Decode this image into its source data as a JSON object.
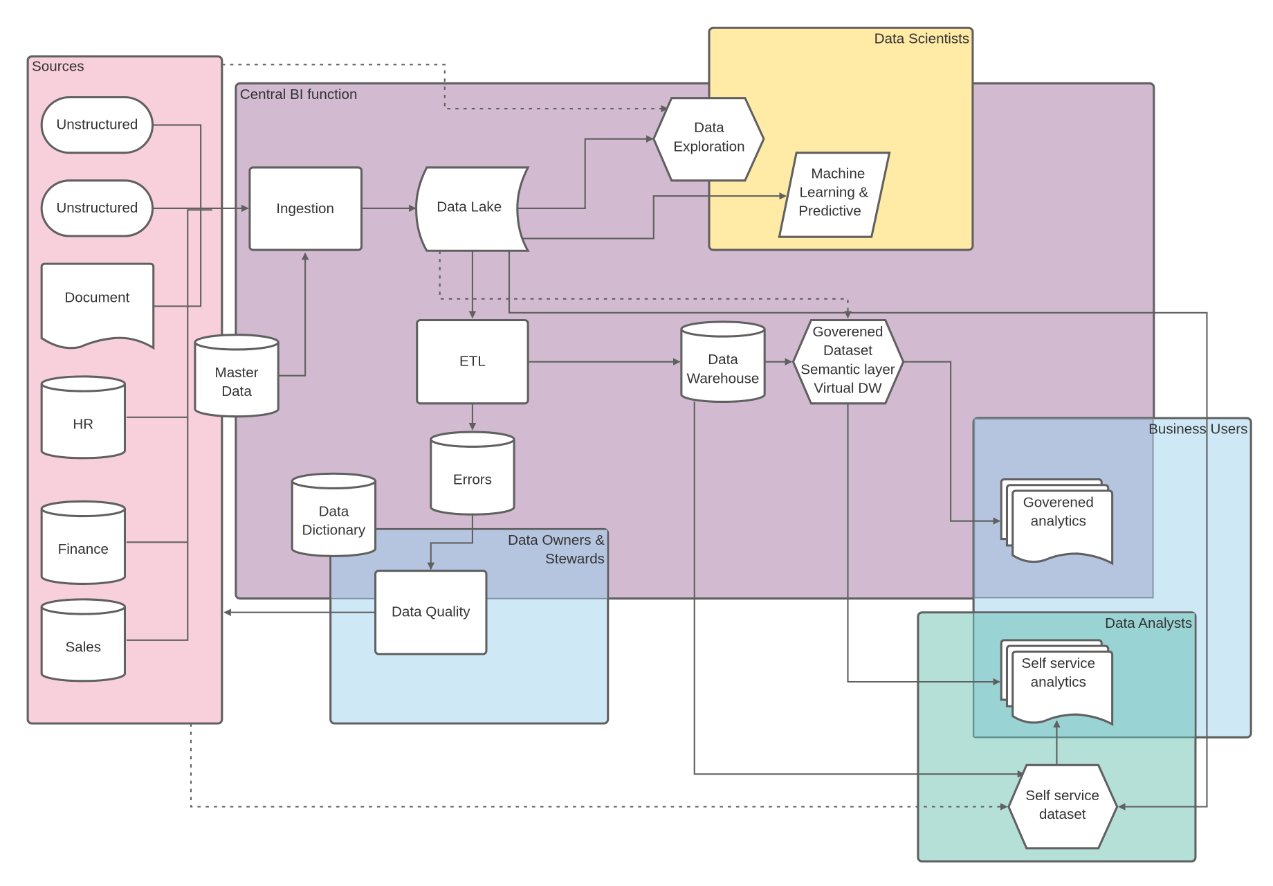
{
  "colors": {
    "sources": "#f8d0dc",
    "central_bi": "#d2bbd0",
    "data_scientists": "#ffeaa6",
    "business_users": "#cfe8f6",
    "data_owners": "#cfe8f6",
    "data_owners_overlap": "#b6c5df",
    "data_analysts": "#b5e0d8",
    "analysts_overlap": "#9ad3d4",
    "stroke": "#606060",
    "text": "#333333"
  },
  "groups": {
    "sources": "Sources",
    "central_bi": "Central BI function",
    "data_scientists": "Data Scientists",
    "business_users": "Business Users",
    "data_owners_line1": "Data Owners &",
    "data_owners_line2": "Stewards",
    "data_analysts": "Data Analysts"
  },
  "nodes": {
    "unstructured_1": "Unstructured",
    "unstructured_2": "Unstructured",
    "document": "Document",
    "hr": "HR",
    "finance": "Finance",
    "sales": "Sales",
    "master_data": [
      "Master",
      "Data"
    ],
    "ingestion": "Ingestion",
    "data_lake": "Data Lake",
    "data_exploration": [
      "Data",
      "Exploration"
    ],
    "machine_learning": [
      "Machine",
      "Learning &",
      "Predictive"
    ],
    "etl": "ETL",
    "errors": "Errors",
    "data_dictionary": [
      "Data",
      "Dictionary"
    ],
    "data_quality": "Data Quality",
    "data_warehouse": [
      "Data",
      "Warehouse"
    ],
    "governed_dataset": [
      "Goverened",
      "Dataset",
      "Semantic layer",
      "Virtual DW"
    ],
    "governed_analytics": [
      "Goverened",
      "analytics"
    ],
    "self_service_analytics": [
      "Self service",
      "analytics"
    ],
    "self_service_dataset": [
      "Self service",
      "dataset"
    ]
  }
}
